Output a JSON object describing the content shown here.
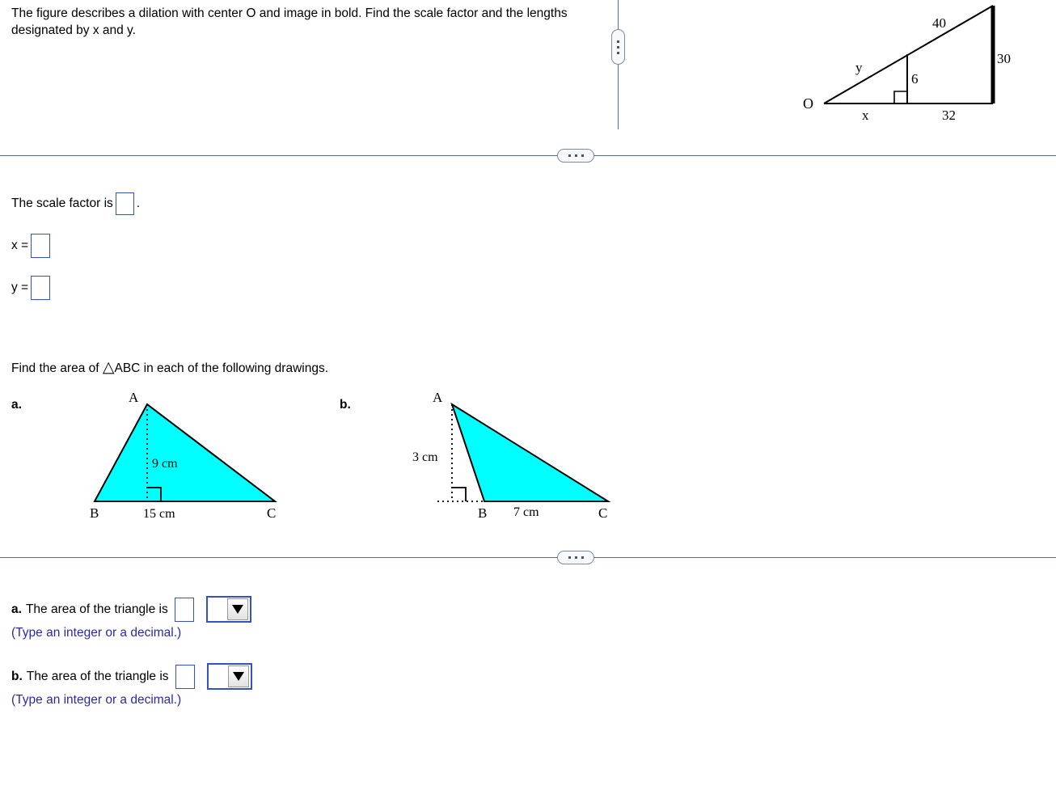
{
  "problem": {
    "prompt_line1": "The figure describes a dilation with center O and image in bold. Find the scale",
    "prompt_line2": "factor and the lengths designated by x and y."
  },
  "dilation_figure": {
    "center_label": "O",
    "labels": {
      "hypotenuse_image": "40",
      "hypotenuse_preimage": "y",
      "inner_height": "6",
      "outer_height": "30",
      "base_preimage": "x",
      "base_remainder": "32"
    }
  },
  "answers_part1": {
    "scale_factor_text": "The scale factor is",
    "scale_factor_period": ".",
    "x_label": "x =",
    "y_label": "y =",
    "scale_factor_value": "",
    "x_value": "",
    "y_value": ""
  },
  "problem2": {
    "prompt": "Find the area of △ABC in each of the following drawings.",
    "triangle_glyph": "△",
    "prompt_prefix": "Find the area of ",
    "prompt_suffix": "ABC in each of the following drawings."
  },
  "figures": [
    {
      "part": "a.",
      "vertex_a": "A",
      "vertex_b": "B",
      "vertex_c": "C",
      "height_label": "9 cm",
      "base_label": "15 cm",
      "fill_color": "#00ffff",
      "stroke_color": "#000000"
    },
    {
      "part": "b.",
      "vertex_a": "A",
      "vertex_b": "B",
      "vertex_c": "C",
      "height_label": "3 cm",
      "base_label": "7 cm",
      "fill_color": "#00ffff",
      "stroke_color": "#000000"
    }
  ],
  "answers_part2": [
    {
      "part": "a.",
      "text": "The area of the triangle is",
      "value": "",
      "unit_selected": "",
      "hint": "(Type an integer or a decimal.)"
    },
    {
      "part": "b.",
      "text": "The area of the triangle is",
      "value": "",
      "unit_selected": "",
      "hint": "(Type an integer or a decimal.)"
    }
  ],
  "divider": {
    "dots": "• • •"
  },
  "colors": {
    "input_border": "#3352c8",
    "hint_text": "#2a2aa8",
    "divider": "#5b6b80",
    "triangle_fill": "#00ffff"
  }
}
